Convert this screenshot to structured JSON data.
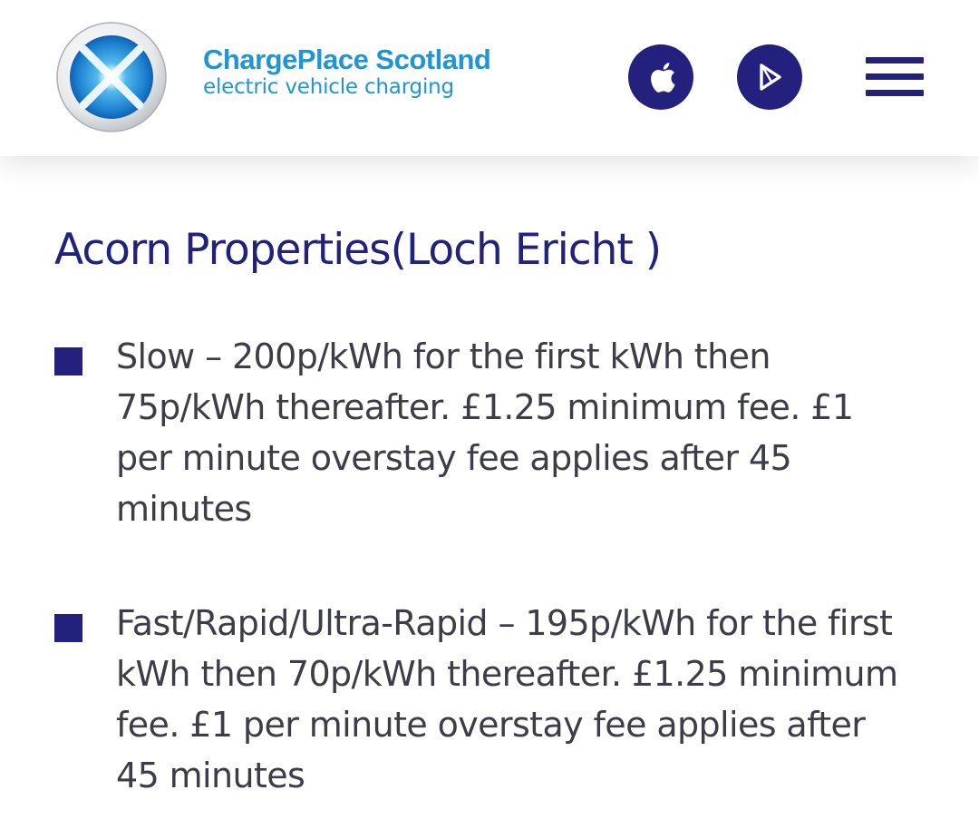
{
  "header": {
    "brand_name": "ChargePlace Scotland",
    "brand_tagline": "electric vehicle charging",
    "icons": {
      "logo": "chargeplace-x-logo-icon",
      "app_store": "apple-icon",
      "play_store": "play-icon",
      "menu": "hamburger-menu-icon"
    },
    "colors": {
      "brand_blue": "#1f95d3",
      "navy": "#23217d"
    }
  },
  "main": {
    "title": "Acorn Properties(Loch Ericht )",
    "tariffs": [
      {
        "text": "Slow – 200p/kWh for the first kWh then 75p/kWh thereafter. £1.25 minimum fee. £1 per minute overstay fee applies after 45 minutes"
      },
      {
        "text": "Fast/Rapid/Ultra-Rapid – 195p/kWh for the first kWh then 70p/kWh thereafter. £1.25 minimum fee. £1 per minute overstay fee applies after 45 minutes"
      }
    ]
  }
}
